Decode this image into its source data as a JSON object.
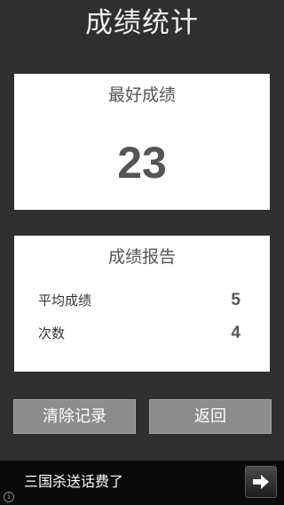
{
  "header": {
    "title": "成绩统计"
  },
  "best_score": {
    "label": "最好成绩",
    "value": "23"
  },
  "report": {
    "title": "成绩报告",
    "rows": [
      {
        "label": "平均成绩",
        "value": "5"
      },
      {
        "label": "次数",
        "value": "4"
      }
    ]
  },
  "buttons": {
    "clear_label": "清除记录",
    "back_label": "返回"
  },
  "ad": {
    "text": "三国杀送话费了",
    "arrow_icon": "arrow-right-icon",
    "info_icon": "info-icon"
  }
}
